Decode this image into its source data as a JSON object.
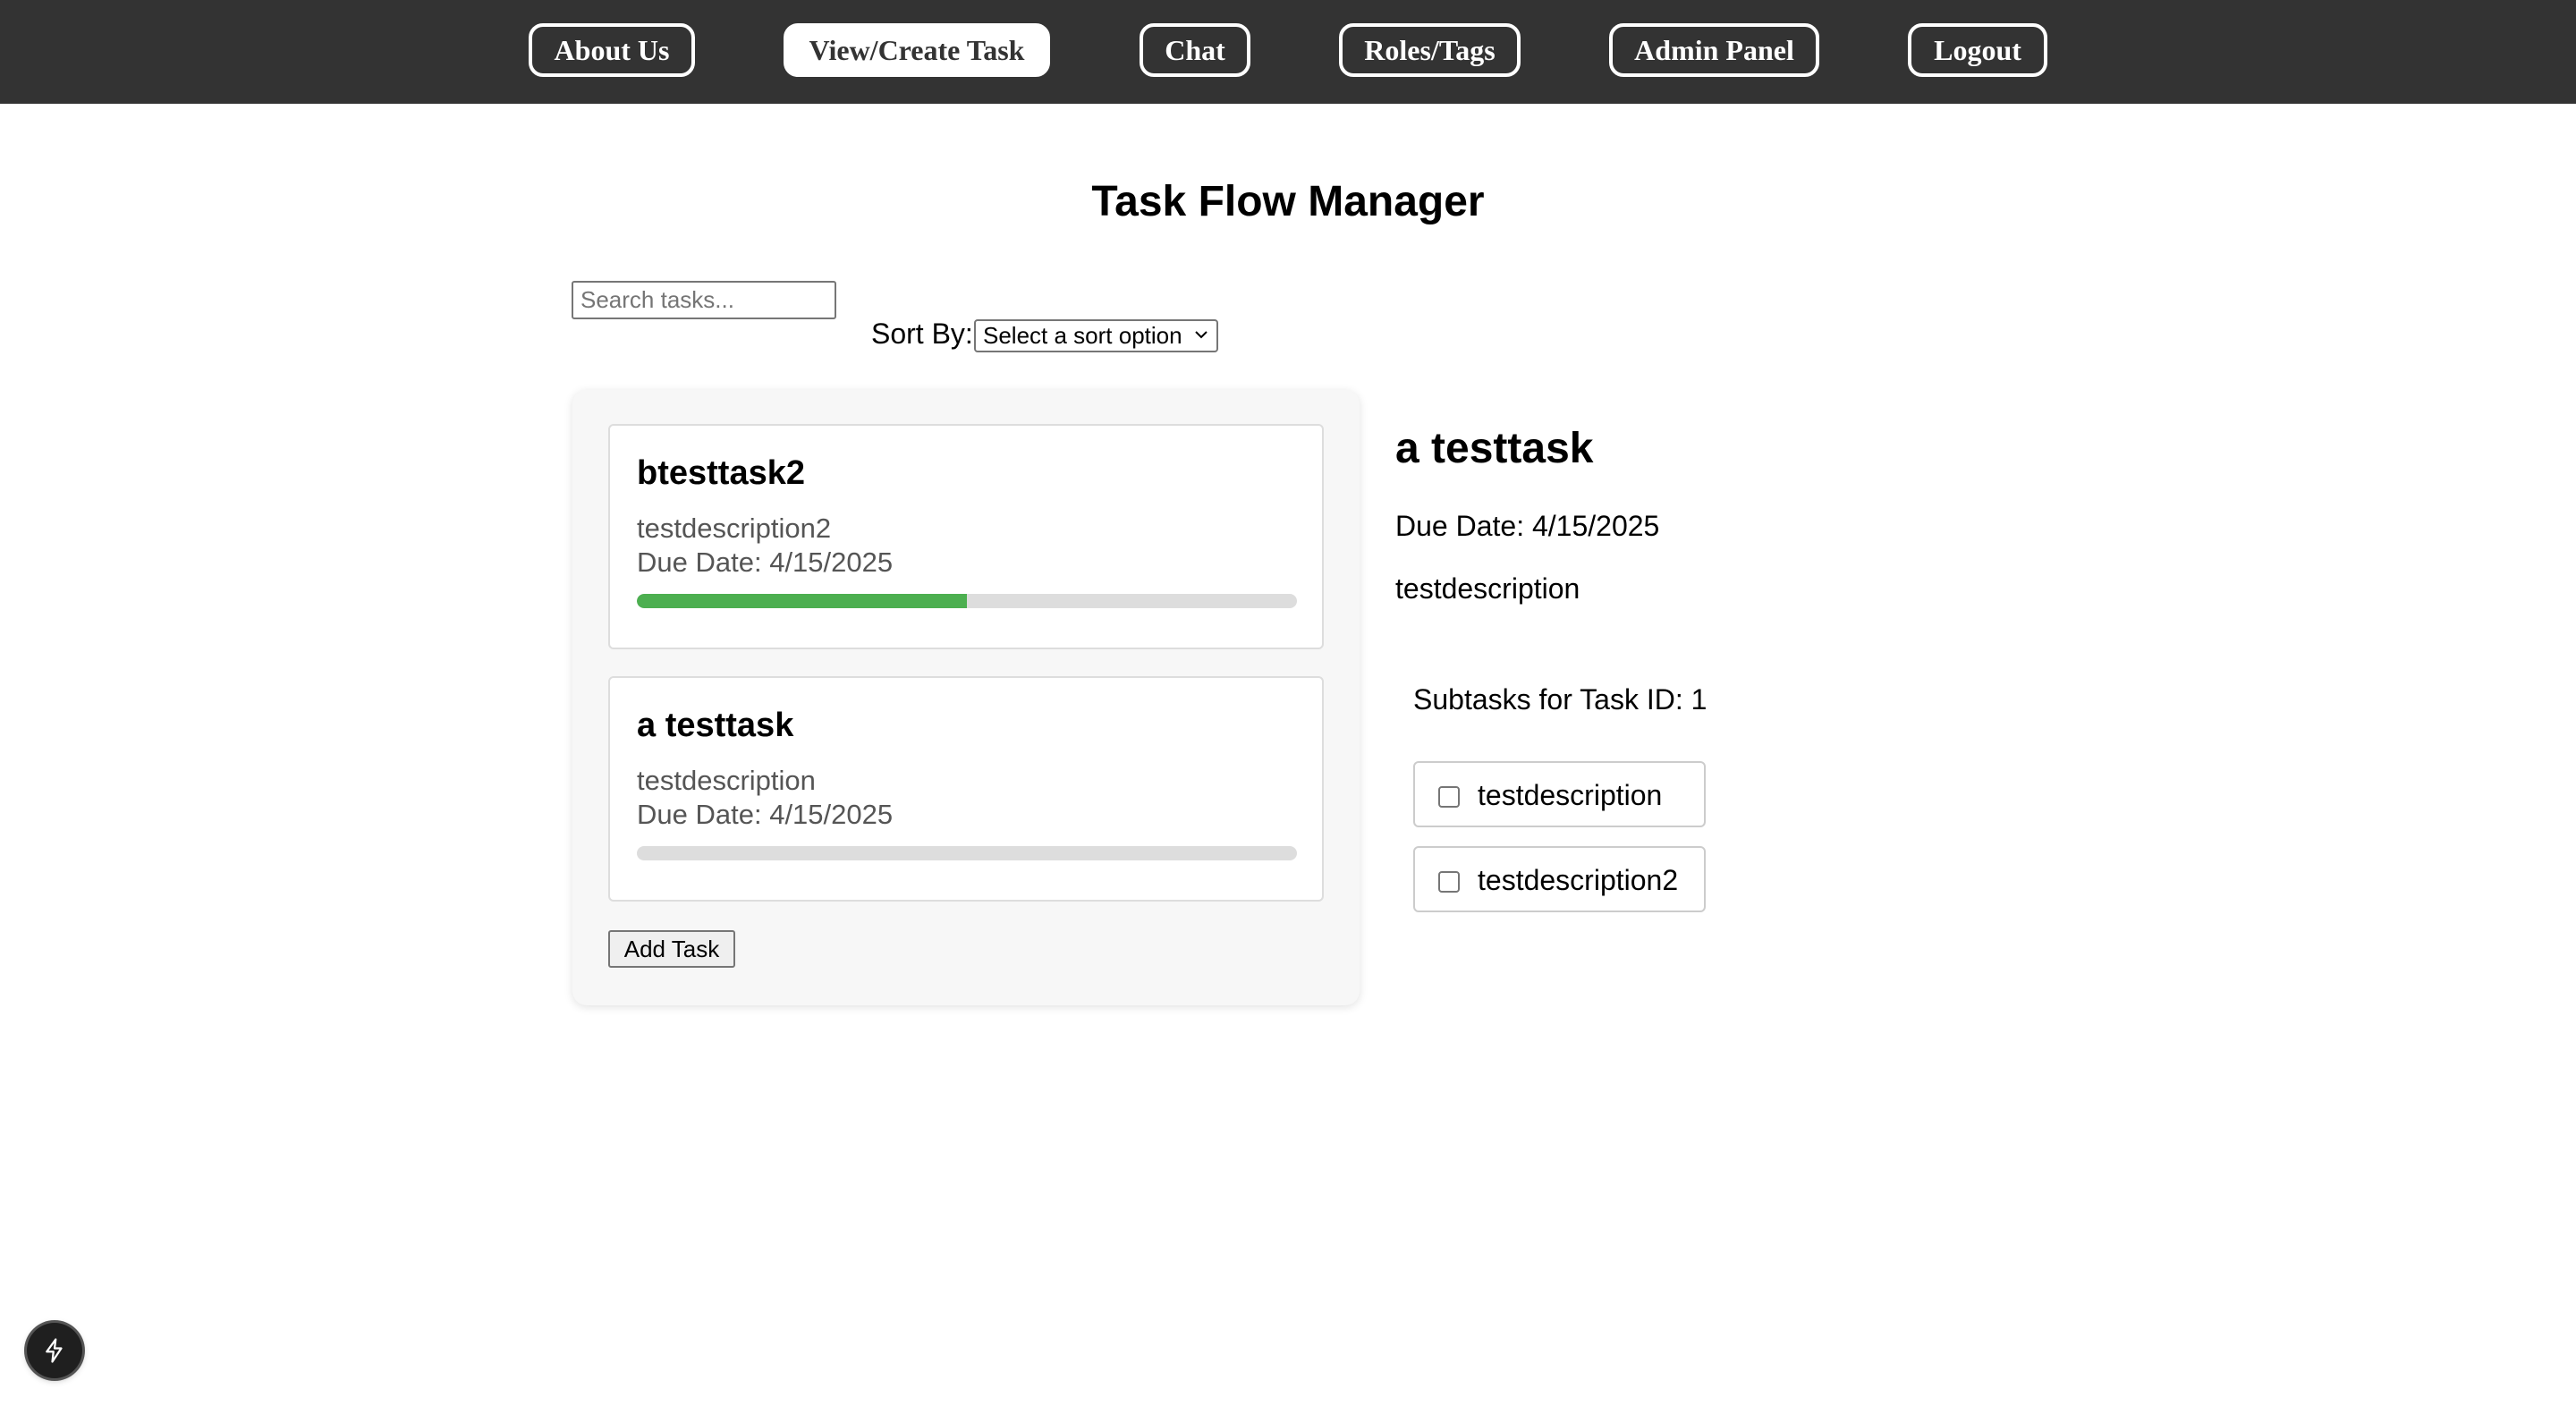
{
  "nav": {
    "about": "About Us",
    "view_create": "View/Create Task",
    "chat": "Chat",
    "roles_tags": "Roles/Tags",
    "admin": "Admin Panel",
    "logout": "Logout",
    "active": "View/Create Task"
  },
  "page": {
    "title": "Task Flow Manager"
  },
  "search": {
    "placeholder": "Search tasks...",
    "value": ""
  },
  "sort": {
    "label": "Sort By:",
    "selected": "Select a sort option"
  },
  "tasks": [
    {
      "title": "btesttask2",
      "description": "testdescription2",
      "due_label": "Due Date:",
      "due_date": "4/15/2025",
      "progress": 0.5
    },
    {
      "title": "a testtask",
      "description": "testdescription",
      "due_label": "Due Date:",
      "due_date": "4/15/2025",
      "progress": 0
    }
  ],
  "add_task_label": "Add Task",
  "detail": {
    "title": "a testtask",
    "due": "Due Date: 4/15/2025",
    "description": "testdescription",
    "subtasks_heading": "Subtasks for Task ID: 1",
    "subtasks": [
      {
        "label": "testdescription",
        "checked": false
      },
      {
        "label": "testdescription2",
        "checked": false
      }
    ]
  },
  "icons": {
    "floating_button": "bolt-icon",
    "sort_dropdown": "chevron-down-icon"
  },
  "colors": {
    "navbar_bg": "#333333",
    "progress_fill": "#4caf50",
    "progress_track": "#dddddd"
  }
}
